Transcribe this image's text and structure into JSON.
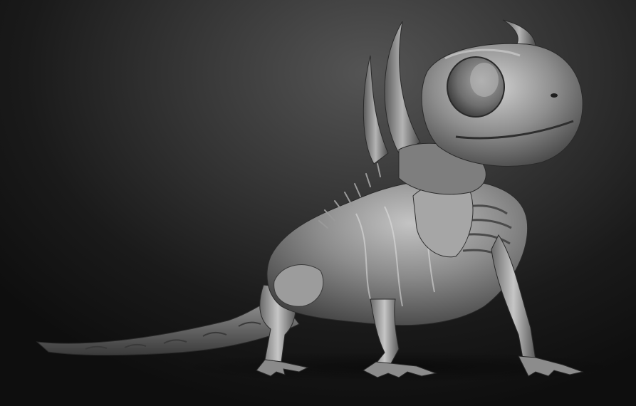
{
  "scene": {
    "subject": "sculpted-lizard-creature",
    "render_style": "grey-clay-matcap",
    "background": {
      "top_color": "#555555",
      "bottom_color": "#0e0e0e"
    },
    "colors": {
      "clay_light": "#c9c9c9",
      "clay_mid": "#8a8a8a",
      "clay_dark": "#3c3c3c"
    }
  }
}
